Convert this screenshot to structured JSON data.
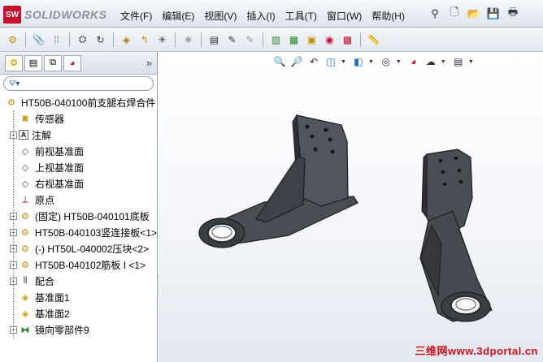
{
  "app": {
    "logo_badge": "SW",
    "logo_text": "SOLIDWORKS"
  },
  "menu": {
    "items": [
      {
        "label": "文件(F)"
      },
      {
        "label": "编辑(E)"
      },
      {
        "label": "视图(V)"
      },
      {
        "label": "插入(I)"
      },
      {
        "label": "工具(T)"
      },
      {
        "label": "窗口(W)"
      },
      {
        "label": "帮助(H)"
      }
    ]
  },
  "feature_tree": {
    "root": "HT50B-040100前支腿右焊合件",
    "items": [
      {
        "label": "传感器",
        "icon": "sensor-icon",
        "expandable": false
      },
      {
        "label": "注解",
        "icon": "annotation-icon",
        "expandable": true
      },
      {
        "label": "前视基准面",
        "icon": "plane-icon",
        "expandable": false
      },
      {
        "label": "上视基准面",
        "icon": "plane-icon",
        "expandable": false
      },
      {
        "label": "右视基准面",
        "icon": "plane-icon",
        "expandable": false
      },
      {
        "label": "原点",
        "icon": "origin-icon",
        "expandable": false
      },
      {
        "label": "(固定) HT50B-040101底板",
        "icon": "part-icon",
        "expandable": true
      },
      {
        "label": "HT50B-040103竖连接板<1>",
        "icon": "part-icon",
        "expandable": true
      },
      {
        "label": "(-) HT50L-040002压块<2>",
        "icon": "part-icon",
        "expandable": true
      },
      {
        "label": "HT50B-040102筋板 I <1>",
        "icon": "part-icon",
        "expandable": true
      },
      {
        "label": "配合",
        "icon": "mate-icon",
        "expandable": true
      },
      {
        "label": "基准面1",
        "icon": "plane-icon",
        "expandable": false
      },
      {
        "label": "基准面2",
        "icon": "plane-icon",
        "expandable": false
      },
      {
        "label": "镜向零部件9",
        "icon": "mirror-icon",
        "expandable": true
      }
    ]
  },
  "watermark": "三维网www.3dportal.cn",
  "colors": {
    "part_fill": "#4b4d55",
    "part_edge": "#1c1d22",
    "watermark": "#d0101c"
  }
}
